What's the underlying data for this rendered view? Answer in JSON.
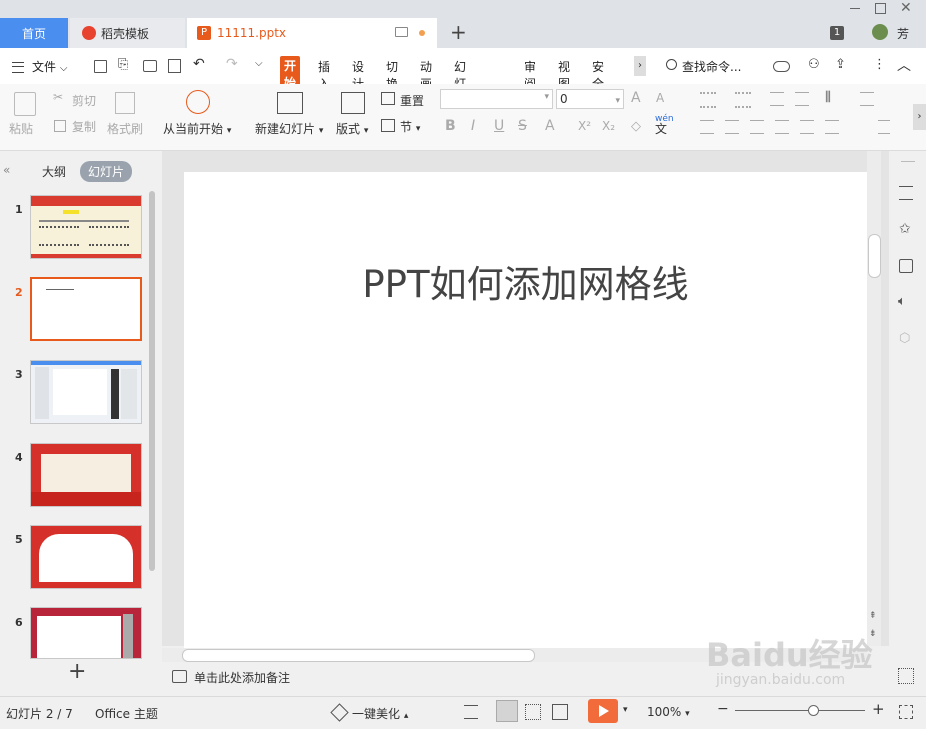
{
  "tabs": {
    "home": "首页",
    "templates": "稻壳模板",
    "file": "11111.pptx"
  },
  "window": {
    "badge": "1",
    "user": "芳"
  },
  "menu": {
    "file": "文件",
    "items": [
      "开始",
      "插入",
      "设计",
      "切换",
      "动画",
      "幻灯片放映",
      "审阅",
      "视图",
      "安全"
    ],
    "active_index": 0,
    "search": "查找命令..."
  },
  "ribbon": {
    "paste": "粘贴",
    "cut": "剪切",
    "copy": "复制",
    "format_painter": "格式刷",
    "from_current": "从当前开始",
    "new_slide": "新建幻灯片",
    "layout": "版式",
    "reset": "重置",
    "section": "节",
    "font_name": "",
    "font_size": "0",
    "bold": "B",
    "italic": "I",
    "underline": "U",
    "strike": "S",
    "fontcolor": "A",
    "superscript": "X²",
    "subscript": "X₂",
    "wen": "wén",
    "wen2": "文"
  },
  "panel": {
    "outline_tab": "大纲",
    "slides_tab": "幻灯片"
  },
  "slides": [
    {
      "num": "1"
    },
    {
      "num": "2"
    },
    {
      "num": "3"
    },
    {
      "num": "4"
    },
    {
      "num": "5"
    },
    {
      "num": "6"
    }
  ],
  "selected_slide": "2",
  "slide": {
    "title": "PPT如何添加网格线"
  },
  "notes_placeholder": "单击此处添加备注",
  "status": {
    "slide_info": "幻灯片 2 / 7",
    "theme": "Office 主题",
    "beautify": "一键美化",
    "zoom": "100%",
    "zoom_level": 0.6
  },
  "watermark": {
    "logo": "Baidu经验",
    "url": "jingyan.baidu.com"
  },
  "colors": {
    "accent": "#e85a1c",
    "tab_blue": "#4a8ef0",
    "play": "#f26b3a"
  }
}
